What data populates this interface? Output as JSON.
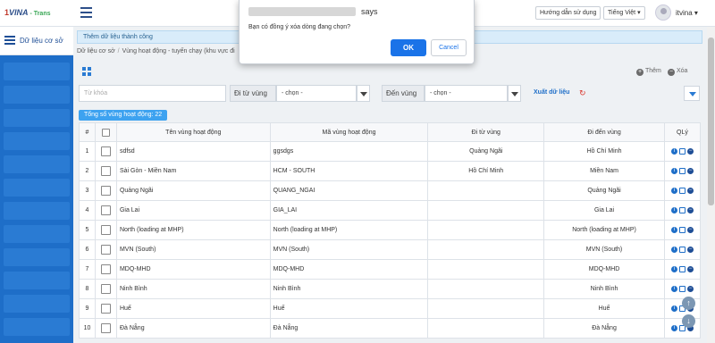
{
  "app": {
    "logo_prefix": "1",
    "logo_name": "VINA",
    "logo_suffix": "- Trans"
  },
  "header": {
    "help_label": "Hướng dẫn sử dụng",
    "language_label": "Tiếng Việt",
    "user_label": "itvina ▾"
  },
  "sidebar": {
    "title": "Dữ liệu cơ sở"
  },
  "alert": {
    "text": "Thêm dữ liệu thành công"
  },
  "breadcrumb": [
    "Dữ liệu cơ sở",
    "Vùng hoạt động - tuyến chạy (khu vực đi"
  ],
  "toolbar": {
    "add_label": "Thêm",
    "delete_label": "Xóa"
  },
  "filters": {
    "keyword_placeholder": "Từ khóa",
    "from_label": "Đi từ vùng",
    "from_value": "- chọn -",
    "to_label": "Đến vùng",
    "to_value": "- chọn -",
    "export_label": "Xuất dữ liệu"
  },
  "summary": {
    "count_label": "Tổng số vùng hoạt động: 22"
  },
  "table": {
    "headers": [
      "#",
      "",
      "Tên vùng hoạt động",
      "Mã vùng hoạt động",
      "Đi từ vùng",
      "Đi đến vùng",
      "QLý"
    ],
    "rows": [
      {
        "no": "1",
        "name": "sdfsd",
        "code": "ggsdgs",
        "from": "Quảng Ngãi",
        "to": "Hồ Chí Minh"
      },
      {
        "no": "2",
        "name": "Sài Gòn - Miền Nam",
        "code": "HCM - SOUTH",
        "from": "Hồ Chí Minh",
        "to": "Miền Nam"
      },
      {
        "no": "3",
        "name": "Quảng Ngãi",
        "code": "QUANG_NGAI",
        "from": "",
        "to": "Quảng Ngãi"
      },
      {
        "no": "4",
        "name": "Gia Lai",
        "code": "GIA_LAI",
        "from": "",
        "to": "Gia Lai"
      },
      {
        "no": "5",
        "name": "North (loading at MHP)",
        "code": "North (loading at MHP)",
        "from": "",
        "to": "North (loading at MHP)"
      },
      {
        "no": "6",
        "name": "MVN (South)",
        "code": "MVN (South)",
        "from": "",
        "to": "MVN (South)"
      },
      {
        "no": "7",
        "name": "MDQ-MHD",
        "code": "MDQ-MHD",
        "from": "",
        "to": "MDQ-MHD"
      },
      {
        "no": "8",
        "name": "Ninh Bình",
        "code": "Ninh Bình",
        "from": "",
        "to": "Ninh Bình"
      },
      {
        "no": "9",
        "name": "Huế",
        "code": "Huế",
        "from": "",
        "to": "Huế"
      },
      {
        "no": "10",
        "name": "Đà Nẵng",
        "code": "Đà Nẵng",
        "from": "",
        "to": "Đà Nẵng"
      }
    ]
  },
  "dialog": {
    "says": "says",
    "message": "Bạn có đồng ý xóa dòng đang chọn?",
    "ok_label": "OK",
    "cancel_label": "Cancel"
  },
  "colors": {
    "brand_blue": "#1e6ec8",
    "ok_blue": "#1a73e8",
    "alert_bg": "#d9ecfa"
  }
}
